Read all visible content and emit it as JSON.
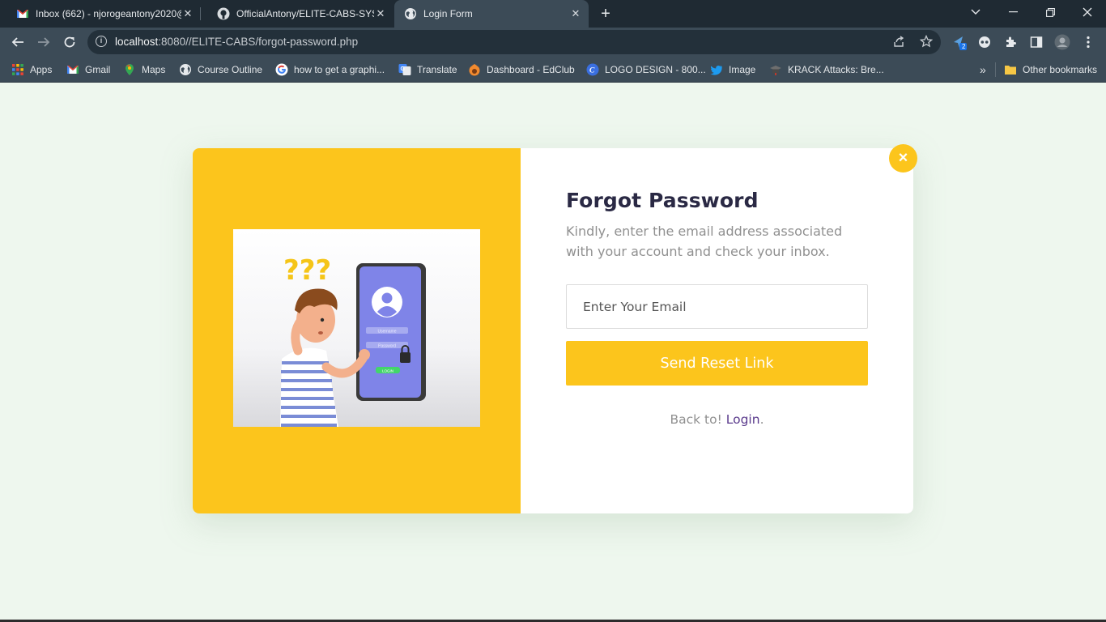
{
  "browser": {
    "tabs": [
      {
        "title": "Inbox (662) - njorogeantony2020@",
        "favicon": "gmail-icon"
      },
      {
        "title": "OfficialAntony/ELITE-CABS-SYSTEM",
        "favicon": "github-icon"
      },
      {
        "title": "Login Form",
        "favicon": "globe-icon",
        "active": true
      }
    ],
    "new_tab": "+",
    "close_glyph": "✕",
    "url_host": "localhost",
    "url_rest": ":8080//ELITE-CABS/forgot-password.php",
    "extension_badge": "2",
    "bookmarks": [
      {
        "label": "Apps",
        "icon": "apps-grid-icon"
      },
      {
        "label": "Gmail",
        "icon": "gmail-icon"
      },
      {
        "label": "Maps",
        "icon": "maps-icon"
      },
      {
        "label": "Course Outline",
        "icon": "globe-icon"
      },
      {
        "label": "how to get a graphi...",
        "icon": "google-icon"
      },
      {
        "label": "Translate",
        "icon": "translate-icon"
      },
      {
        "label": "Dashboard - EdClub",
        "icon": "edclub-icon"
      },
      {
        "label": "LOGO DESIGN - 800...",
        "icon": "canva-icon"
      },
      {
        "label": "Image",
        "icon": "twitter-icon"
      },
      {
        "label": "KRACK Attacks: Bre...",
        "icon": "krack-icon"
      }
    ],
    "bookmarks_overflow": "»",
    "other_bookmarks": "Other bookmarks"
  },
  "form": {
    "heading": "Forgot Password",
    "description": "Kindly, enter the email address associated with your account and check your inbox.",
    "email_placeholder": "Enter Your Email",
    "submit_label": "Send Reset Link",
    "back_prefix": "Back to! ",
    "back_link": "Login",
    "back_suffix": ".",
    "close_glyph": "×"
  },
  "illustration": {
    "question_marks": "???",
    "username_label": "Username",
    "password_label": "Password",
    "login_label": "LOGIN"
  },
  "colors": {
    "accent": "#fcc51c",
    "page_bg": "#eef7ee",
    "heading": "#2a2944",
    "link": "#5a3a8c"
  }
}
